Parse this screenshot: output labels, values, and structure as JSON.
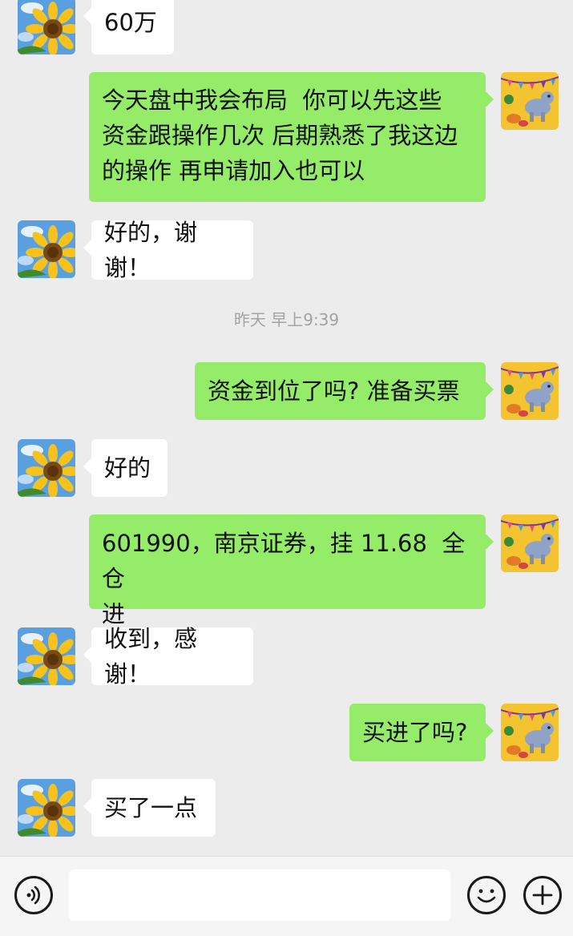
{
  "conversation": {
    "timestamp": "昨天 早上9:39",
    "messages": [
      {
        "id": "m1",
        "side": "in",
        "text": "60万"
      },
      {
        "id": "m2",
        "side": "out",
        "lines": [
          "今天盘中我会布局  你可以先这些",
          "资金跟操作几次 后期熟悉了我这边",
          "的操作 再申请加入也可以"
        ]
      },
      {
        "id": "m3",
        "side": "in",
        "text": "好的，谢谢！"
      },
      {
        "id": "m4",
        "side": "out",
        "text": "资金到位了吗? 准备买票"
      },
      {
        "id": "m5",
        "side": "in",
        "text": "好的"
      },
      {
        "id": "m6",
        "side": "out",
        "lines": [
          "601990，南京证券，挂 11.68  全仓",
          "进"
        ]
      },
      {
        "id": "m7",
        "side": "in",
        "text": "收到，感谢！"
      },
      {
        "id": "m8",
        "side": "out",
        "text": "买进了吗?"
      },
      {
        "id": "m9",
        "side": "in",
        "text": "买了一点"
      }
    ]
  },
  "avatars": {
    "contact": "sunflower-avatar",
    "self": "cartoon-dinosaur-avatar"
  },
  "input_bar": {
    "voice_icon": "voice-icon",
    "emoji_icon": "emoji-icon",
    "plus_icon": "plus-icon",
    "message_value": ""
  },
  "colors": {
    "background": "#ececec",
    "outgoing_bubble": "#95ec69",
    "incoming_bubble": "#ffffff",
    "timestamp_text": "#a3a3a3"
  }
}
